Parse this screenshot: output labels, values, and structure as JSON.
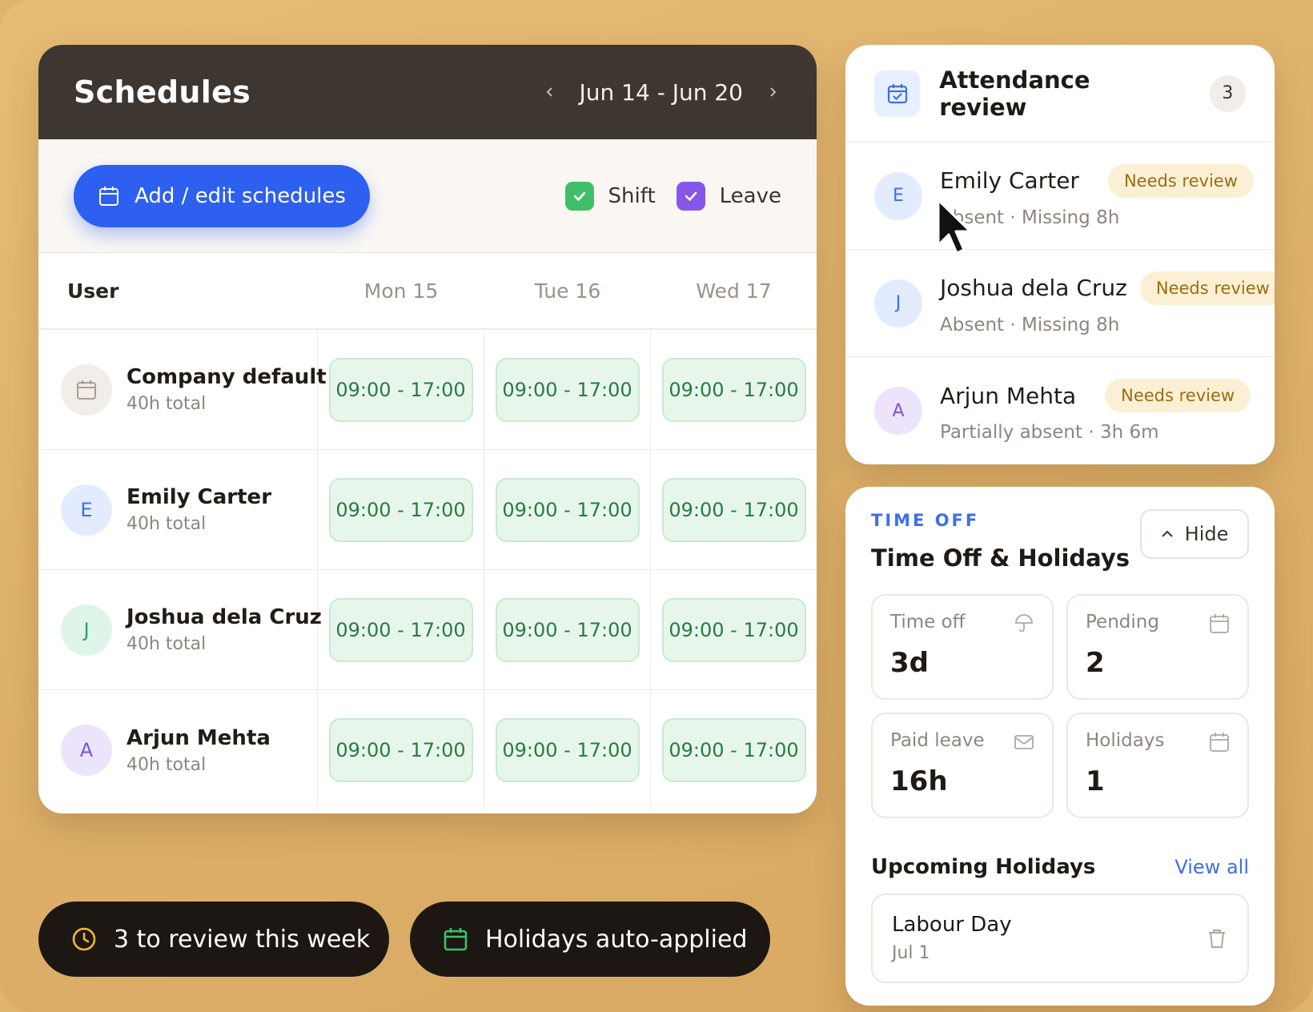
{
  "schedules": {
    "title": "Schedules",
    "week_range": "Jun 14 - Jun 20",
    "add_button": "Add / edit schedules",
    "legend": {
      "shift": "Shift",
      "leave": "Leave"
    },
    "columns": {
      "user": "User",
      "days": [
        "Mon 15",
        "Tue 16",
        "Wed 17"
      ]
    },
    "rows": [
      {
        "name": "Company default",
        "total": "40h total",
        "avatar": "calendar-icon",
        "shifts": [
          "09:00 - 17:00",
          "09:00 - 17:00",
          "09:00 - 17:00"
        ]
      },
      {
        "name": "Emily Carter",
        "total": "40h total",
        "avatar": "E",
        "shifts": [
          "09:00 - 17:00",
          "09:00 - 17:00",
          "09:00 - 17:00"
        ]
      },
      {
        "name": "Joshua dela Cruz",
        "total": "40h total",
        "avatar": "J",
        "shifts": [
          "09:00 - 17:00",
          "09:00 - 17:00",
          "09:00 - 17:00"
        ]
      },
      {
        "name": "Arjun Mehta",
        "total": "40h total",
        "avatar": "A",
        "shifts": [
          "09:00 - 17:00",
          "09:00 - 17:00",
          "09:00 - 17:00"
        ]
      }
    ]
  },
  "pills": {
    "review": "3 to review this week",
    "holidays": "Holidays auto-applied"
  },
  "attendance": {
    "title": "Attendance review",
    "count": "3",
    "items": [
      {
        "initial": "E",
        "name": "Emily Carter",
        "badge": "Needs review",
        "detail": "Absent · Missing 8h"
      },
      {
        "initial": "J",
        "name": "Joshua dela Cruz",
        "badge": "Needs review",
        "detail": "Absent · Missing 8h"
      },
      {
        "initial": "A",
        "name": "Arjun Mehta",
        "badge": "Needs review",
        "detail": "Partially absent · 3h 6m"
      }
    ]
  },
  "time_off": {
    "kicker": "TIME OFF",
    "title": "Time Off & Holidays",
    "hide_label": "Hide",
    "stats": [
      {
        "label": "Time off",
        "value": "3d",
        "icon": "umbrella-icon"
      },
      {
        "label": "Pending",
        "value": "2",
        "icon": "calendar-icon"
      },
      {
        "label": "Paid leave",
        "value": "16h",
        "icon": "mail-icon"
      },
      {
        "label": "Holidays",
        "value": "1",
        "icon": "calendar-icon"
      }
    ],
    "upcoming_title": "Upcoming Holidays",
    "view_all": "View all",
    "holiday": {
      "name": "Labour Day",
      "date": "Jul 1"
    }
  },
  "colors": {
    "background": "#e0b36e",
    "primary": "#2d5ff0",
    "header_dark": "#3e3630",
    "shift_green": "#e7f6eb",
    "review_badge": "#fbf0d3"
  }
}
